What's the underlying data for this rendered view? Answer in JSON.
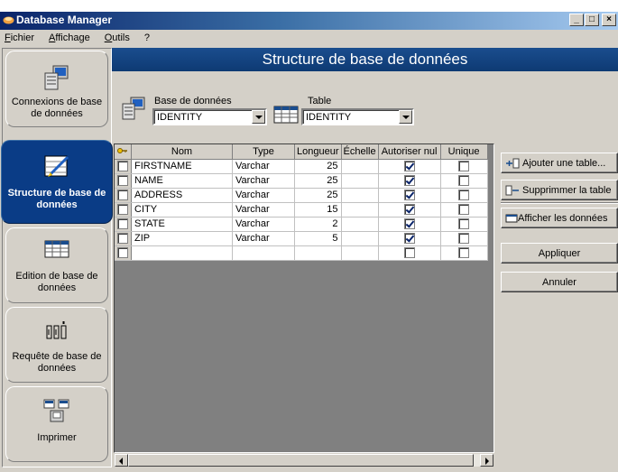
{
  "window": {
    "title": "Database Manager",
    "controls": {
      "minimize": "_",
      "maximize": "□",
      "close": "×"
    }
  },
  "menu": [
    {
      "prefix": "",
      "mnemonic": "F",
      "rest": "ichier"
    },
    {
      "prefix": "",
      "mnemonic": "A",
      "rest": "ffichage"
    },
    {
      "prefix": "",
      "mnemonic": "O",
      "rest": "utils"
    },
    {
      "prefix": "",
      "mnemonic": "",
      "rest": "?"
    }
  ],
  "nav": [
    {
      "label": "Connexions de base de données",
      "icon": "database-connection-icon",
      "active": false
    },
    {
      "label": "Structure de base de données",
      "icon": "structure-edit-icon",
      "active": true
    },
    {
      "label": "Edition de base de données",
      "icon": "table-edit-icon",
      "active": false
    },
    {
      "label": "Requête de base de données",
      "icon": "query-icon",
      "active": false
    },
    {
      "label": "Imprimer",
      "icon": "print-icon",
      "active": false
    }
  ],
  "header": {
    "title": "Structure de base de données"
  },
  "database": {
    "label": "Base de données",
    "value": "IDENTITY"
  },
  "table_select": {
    "label": "Table",
    "value": "IDENTITY"
  },
  "grid": {
    "columns": [
      "Nom",
      "Type",
      "Longueur",
      "Échelle",
      "Autoriser nul",
      "Unique"
    ],
    "rows": [
      {
        "name": "FIRSTNAME",
        "type": "Varchar",
        "length": "25",
        "scale": "",
        "nullable": true,
        "unique": false
      },
      {
        "name": "NAME",
        "type": "Varchar",
        "length": "25",
        "scale": "",
        "nullable": true,
        "unique": false
      },
      {
        "name": "ADDRESS",
        "type": "Varchar",
        "length": "25",
        "scale": "",
        "nullable": true,
        "unique": false
      },
      {
        "name": "CITY",
        "type": "Varchar",
        "length": "15",
        "scale": "",
        "nullable": true,
        "unique": false
      },
      {
        "name": "STATE",
        "type": "Varchar",
        "length": "2",
        "scale": "",
        "nullable": true,
        "unique": false
      },
      {
        "name": "ZIP",
        "type": "Varchar",
        "length": "5",
        "scale": "",
        "nullable": true,
        "unique": false
      },
      {
        "name": "",
        "type": "",
        "length": "",
        "scale": "",
        "nullable": false,
        "unique": false
      }
    ]
  },
  "actions": {
    "add_table": "Ajouter une table...",
    "delete_table": "Supprimmer la table",
    "show_data": "Afficher les données",
    "apply": "Appliquer",
    "cancel": "Annuler"
  },
  "colors": {
    "accent": "#0a3c86",
    "titlebar": "#0a246a",
    "face": "#d4d0c8"
  }
}
